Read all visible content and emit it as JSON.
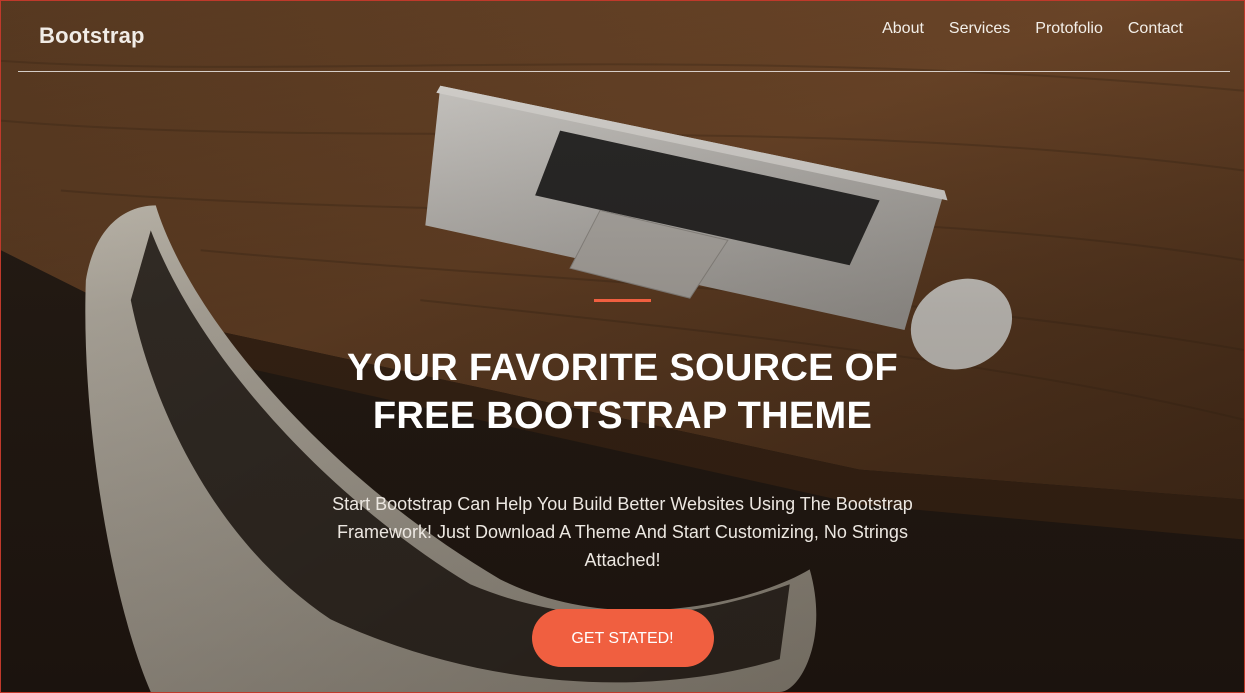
{
  "navbar": {
    "brand": "Bootstrap",
    "links": [
      "About",
      "Services",
      "Protofolio",
      "Contact"
    ]
  },
  "hero": {
    "headline": "YOUR FAVORITE SOURCE OF FREE BOOTSTRAP THEME",
    "subtext": "Start Bootstrap Can Help You Build Better Websites Using The Bootstrap Framework! Just Download A Theme And Start Customizing, No Strings Attached!",
    "cta_label": "GET STATED!"
  },
  "colors": {
    "accent": "#f05f40",
    "text": "#ffffff"
  }
}
